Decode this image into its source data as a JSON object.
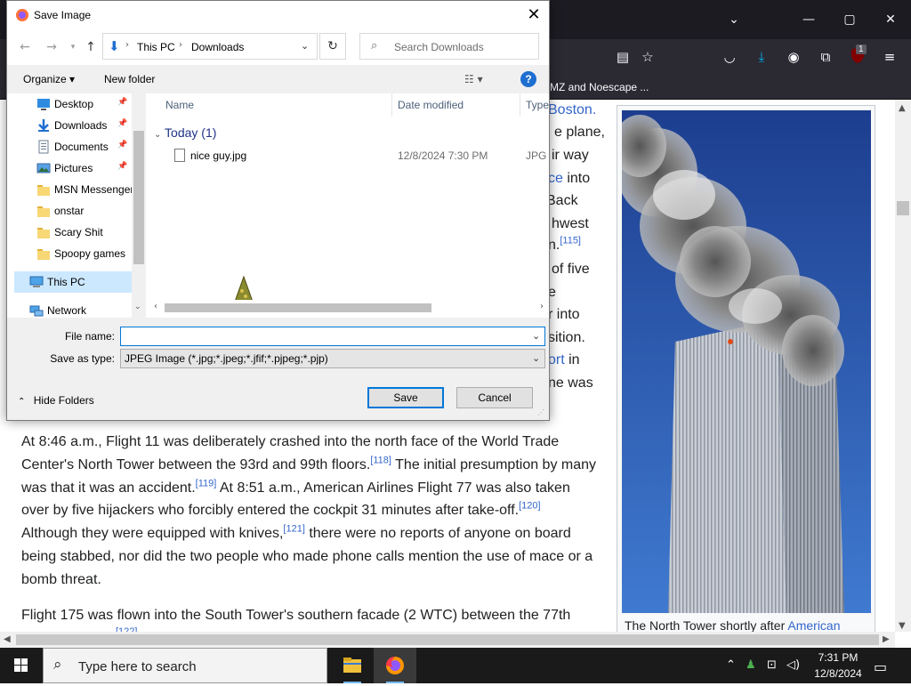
{
  "browser": {
    "window_controls": {
      "tabs_dropdown": "⌄",
      "minimize": "—",
      "maximize": "▢",
      "close": "✕"
    },
    "extension_badge": "1",
    "bookmark_text": "MZ and Noescape ..."
  },
  "article": {
    "right_fragments": [
      {
        "text": "Boston.",
        "link": true
      },
      {
        "text": "e plane,",
        "link": false
      },
      {
        "text": "ir way",
        "link": false
      },
      {
        "text": "ce",
        "link": true,
        "after": " into"
      },
      {
        "text": "Back",
        "link": false
      },
      {
        "text": "hwest",
        "link": false
      },
      {
        "text": "n.",
        "link": false,
        "sup": "[115]"
      },
      {
        "text": "of five",
        "link": false
      },
      {
        "text": "e",
        "link": false
      },
      {
        "text": "r into",
        "link": false
      },
      {
        "text": "sition.",
        "link": false
      },
      {
        "text": "ort",
        "link": true,
        "after": " in"
      },
      {
        "text": "ne was",
        "link": false
      }
    ],
    "para1": {
      "t1": "At 8:46 a.m., Flight 11 was deliberately crashed into the north face of the World Trade Center's North Tower between the 93rd and 99th floors.",
      "s1": "[118]",
      "t2": " The initial presumption by many was that it was an accident.",
      "s2": "[119]",
      "t3": " At 8:51 a.m., American Airlines Flight 77 was also taken over by five hijackers who forcibly entered the cockpit 31 minutes after take-off.",
      "s3": "[120]",
      "t4": " Although they were equipped with knives,",
      "s4": "[121]",
      "t5": " there were no reports of anyone on board being stabbed, nor did the two people who made phone calls mention the use of mace or a bomb threat."
    },
    "para2": "Flight 175 was flown into the South Tower's southern facade (2 WTC) between the 77th",
    "caption": {
      "text": "The North Tower shortly after ",
      "link": "American"
    }
  },
  "dialog": {
    "title": "Save Image",
    "breadcrumb": [
      "This PC",
      "Downloads"
    ],
    "search_placeholder": "Search Downloads",
    "organize_label": "Organize ▾",
    "new_folder_label": "New folder",
    "nav_items": [
      {
        "label": "Desktop",
        "icon": "desktop-icon",
        "pinned": true
      },
      {
        "label": "Downloads",
        "icon": "downloads-icon",
        "pinned": true
      },
      {
        "label": "Documents",
        "icon": "documents-icon",
        "pinned": true
      },
      {
        "label": "Pictures",
        "icon": "pictures-icon",
        "pinned": true
      },
      {
        "label": "MSN Messenger",
        "icon": "folder-icon",
        "pinned": false
      },
      {
        "label": "onstar",
        "icon": "folder-icon",
        "pinned": false
      },
      {
        "label": "Scary Shit",
        "icon": "folder-icon",
        "pinned": false
      },
      {
        "label": "Spoopy games",
        "icon": "folder-icon",
        "pinned": false
      },
      {
        "label": "This PC",
        "icon": "this-pc-icon",
        "pinned": false,
        "selected": true
      },
      {
        "label": "Network",
        "icon": "network-icon",
        "pinned": false
      }
    ],
    "columns": [
      "Name",
      "Date modified",
      "Type"
    ],
    "group_label": "Today (1)",
    "files": [
      {
        "name": "nice guy.jpg",
        "date": "12/8/2024 7:30 PM",
        "type": "JPG File"
      }
    ],
    "file_name_label": "File name:",
    "file_name_value": "",
    "save_type_label": "Save as type:",
    "save_type_value": "JPEG Image (*.jpg;*.jpeg;*.jfif;*.pjpeg;*.pjp)",
    "hide_folders_label": "Hide Folders",
    "save_label": "Save",
    "cancel_label": "Cancel"
  },
  "taskbar": {
    "search_placeholder": "Type here to search",
    "time": "7:31 PM",
    "date": "12/8/2024"
  },
  "colors": {
    "accent": "#0078d7",
    "link": "#3366cc",
    "browser_dark": "#2b2a33",
    "sky": "#1f4fa8"
  }
}
